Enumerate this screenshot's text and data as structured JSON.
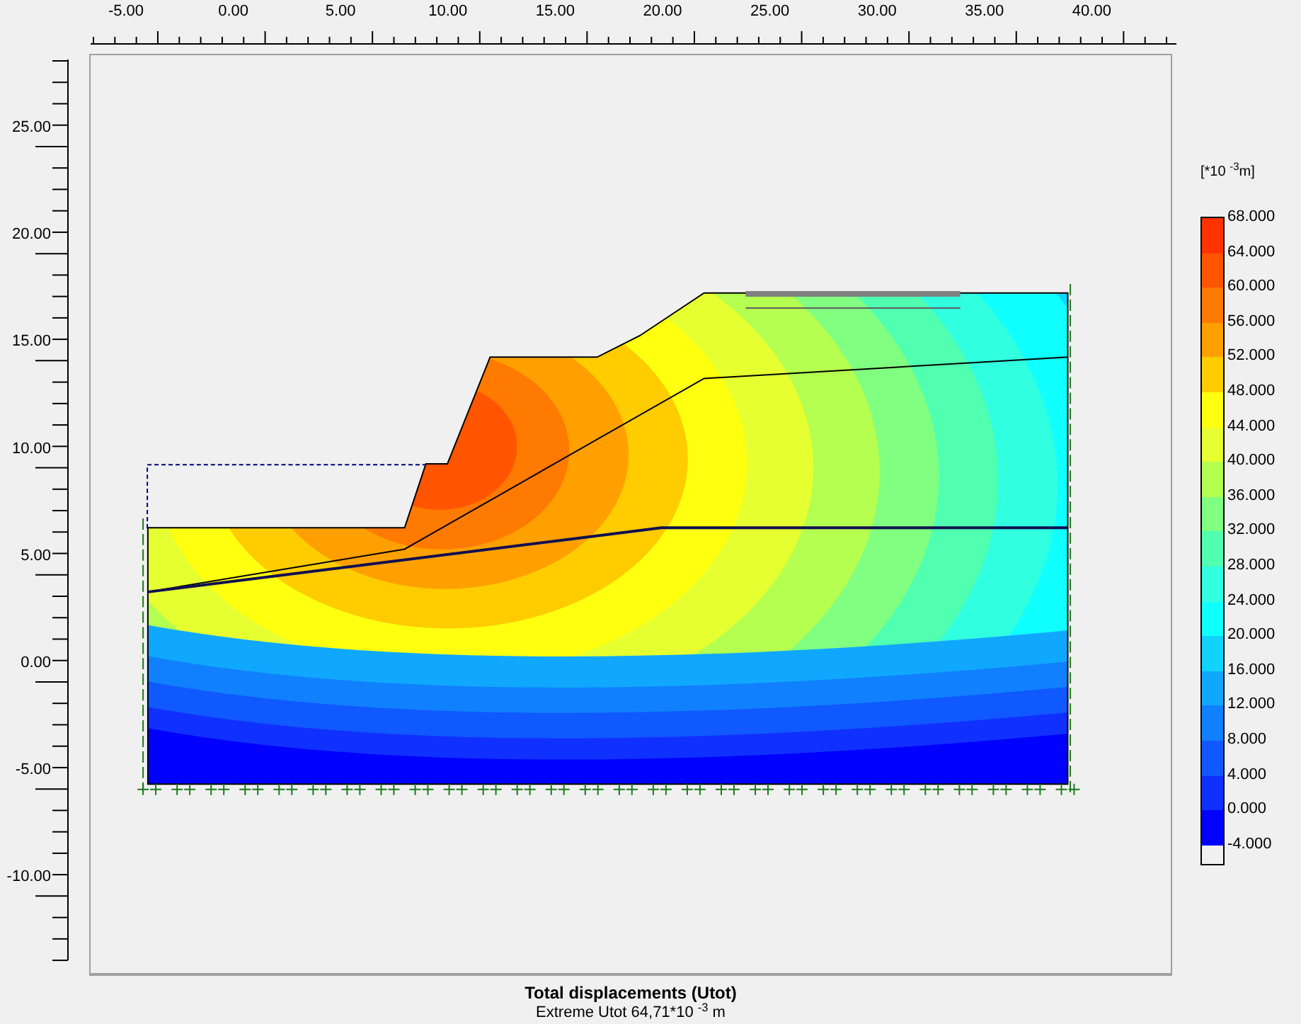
{
  "x_ruler": [
    "-5.00",
    "0.00",
    "5.00",
    "10.00",
    "15.00",
    "20.00",
    "25.00",
    "30.00",
    "35.00",
    "40.00"
  ],
  "y_ruler": [
    "25.00",
    "20.00",
    "15.00",
    "10.00",
    "5.00",
    "0.00",
    "-5.00",
    "-10.00"
  ],
  "legend": {
    "unit": "[*10 $^{-3}$m]",
    "labels": [
      "68.000",
      "64.000",
      "60.000",
      "56.000",
      "52.000",
      "48.000",
      "44.000",
      "40.000",
      "36.000",
      "32.000",
      "28.000",
      "24.000",
      "20.000",
      "16.000",
      "12.000",
      "8.000",
      "4.000",
      "0.000",
      "-4.000"
    ],
    "bands": [
      {
        "color": "#ff3300"
      },
      {
        "color": "#ff5500"
      },
      {
        "color": "#ff7a00"
      },
      {
        "color": "#ffa000"
      },
      {
        "color": "#ffcc00"
      },
      {
        "color": "#ffff10"
      },
      {
        "color": "#e6ff30"
      },
      {
        "color": "#b4ff50"
      },
      {
        "color": "#80ff80"
      },
      {
        "color": "#50ffb0"
      },
      {
        "color": "#30ffe0"
      },
      {
        "color": "#10ffff"
      },
      {
        "color": "#10d4ff"
      },
      {
        "color": "#10a8ff"
      },
      {
        "color": "#1080ff"
      },
      {
        "color": "#1058ff"
      },
      {
        "color": "#1030ff"
      },
      {
        "color": "#0000ff"
      }
    ]
  },
  "caption": {
    "title": "Total displacements (Utot)",
    "extreme": "Extreme Utot 64,71*10 $^{-3}$ m"
  }
}
